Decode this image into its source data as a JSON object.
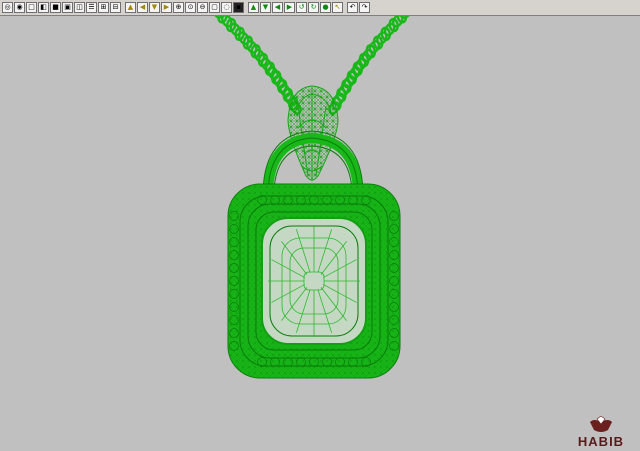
{
  "toolbar": {
    "buttons": [
      {
        "name": "rotate-icon",
        "glyph": "◎",
        "tone": "n"
      },
      {
        "name": "orbit-icon",
        "glyph": "◉",
        "tone": "n"
      },
      {
        "name": "view-single-icon",
        "glyph": "□",
        "tone": "n"
      },
      {
        "name": "view-half-icon",
        "glyph": "◧",
        "tone": "n"
      },
      {
        "name": "view-fill-icon",
        "glyph": "■",
        "tone": "n"
      },
      {
        "name": "view-frame-icon",
        "glyph": "▣",
        "tone": "n"
      },
      {
        "name": "view-split-icon",
        "glyph": "◫",
        "tone": "n"
      },
      {
        "name": "layout-rows-icon",
        "glyph": "☰",
        "tone": "n"
      },
      {
        "name": "layout-grid-icon",
        "glyph": "⊞",
        "tone": "n"
      },
      {
        "name": "layout-cells-icon",
        "glyph": "⊟",
        "tone": "n"
      },
      {
        "name": "move-up-icon",
        "glyph": "▲",
        "tone": "y"
      },
      {
        "name": "move-left-icon",
        "glyph": "◀",
        "tone": "y"
      },
      {
        "name": "move-down-icon",
        "glyph": "▼",
        "tone": "y"
      },
      {
        "name": "move-right-icon",
        "glyph": "▶",
        "tone": "y"
      },
      {
        "name": "zoom-in-icon",
        "glyph": "⊕",
        "tone": "n"
      },
      {
        "name": "zoom-window-icon",
        "glyph": "⊙",
        "tone": "n"
      },
      {
        "name": "zoom-out-icon",
        "glyph": "⊖",
        "tone": "n"
      },
      {
        "name": "zoom-box-icon",
        "glyph": "▢",
        "tone": "n"
      },
      {
        "name": "zoom-extents-icon",
        "glyph": "◌",
        "tone": "n"
      },
      {
        "name": "camera-icon",
        "glyph": "▪",
        "tone": "d"
      },
      {
        "name": "arrow-up-green-icon",
        "glyph": "▲",
        "tone": "g"
      },
      {
        "name": "arrow-down-green-icon",
        "glyph": "▼",
        "tone": "g"
      },
      {
        "name": "arrow-left-green-icon",
        "glyph": "◀",
        "tone": "g"
      },
      {
        "name": "arrow-right-green-icon",
        "glyph": "▶",
        "tone": "g"
      },
      {
        "name": "spin-left-green-icon",
        "glyph": "↺",
        "tone": "g"
      },
      {
        "name": "spin-right-green-icon",
        "glyph": "↻",
        "tone": "g"
      },
      {
        "name": "globe-icon",
        "glyph": "●",
        "tone": "g"
      },
      {
        "name": "select-cursor-icon",
        "glyph": "↖",
        "tone": "y"
      },
      {
        "name": "undo-icon",
        "glyph": "↶",
        "tone": "n"
      },
      {
        "name": "redo-icon",
        "glyph": "↷",
        "tone": "n"
      }
    ]
  },
  "colors": {
    "background": "#c0c0c0",
    "wireframe": "#16b816",
    "wireframe_dark": "#0a7d0a",
    "logo": "#5a1a1a"
  },
  "logo": {
    "text": "HABIB"
  }
}
